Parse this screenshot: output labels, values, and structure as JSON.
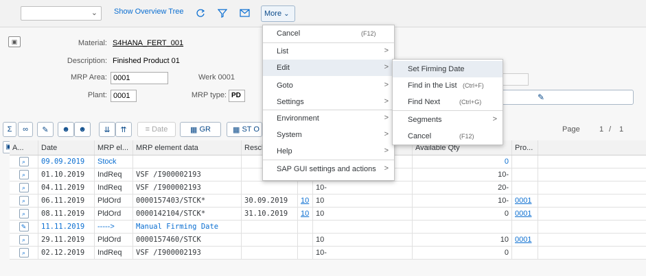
{
  "toolbar": {
    "select_value": "",
    "show_overview_tree": "Show Overview Tree",
    "more": "More"
  },
  "header": {
    "material_label": "Material:",
    "material_value": "S4HANA_FERT_001",
    "description_label": "Description:",
    "description_value": "Finished Product 01",
    "mrp_area_label": "MRP Area:",
    "mrp_area_value": "0001",
    "mrp_area_text": "Werk 0001",
    "plant_label": "Plant:",
    "plant_value": "0001",
    "mrp_type_label": "MRP type:",
    "mrp_type_value": "PD"
  },
  "gridbar": {
    "date_btn": "Date",
    "gr_btn": "GR",
    "st_btn": "ST O",
    "page_label": "Page",
    "page_current": "1",
    "page_sep": "/",
    "page_total": "1"
  },
  "table": {
    "headers": [
      "A...",
      "Date",
      "MRP el...",
      "MRP element data",
      "Resch",
      "",
      "",
      "Available Qty",
      "Pro..."
    ],
    "rows": [
      {
        "icon": "magnifier-icon",
        "date": "09.09.2019",
        "el": "Stock",
        "data": "",
        "resch": "",
        "e": "",
        "rec": "",
        "avail": "0",
        "pro": "",
        "style": "blue"
      },
      {
        "icon": "magnifier-icon",
        "date": "01.10.2019",
        "el": "IndReq",
        "data": "VSF /I900002193",
        "resch": "",
        "e": "",
        "rec": "10-",
        "avail": "10-",
        "pro": "",
        "style": ""
      },
      {
        "icon": "magnifier-icon",
        "date": "04.11.2019",
        "el": "IndReq",
        "data": "VSF /I900002193",
        "resch": "",
        "e": "",
        "rec": "10-",
        "avail": "20-",
        "pro": "",
        "style": ""
      },
      {
        "icon": "magnifier-icon",
        "date": "06.11.2019",
        "el": "PldOrd",
        "data": "0000157403/STCK*",
        "resch": "30.09.2019",
        "e": "10",
        "rec": "10",
        "avail": "10-",
        "pro": "0001",
        "style": ""
      },
      {
        "icon": "magnifier-icon",
        "date": "08.11.2019",
        "el": "PldOrd",
        "data": "0000142104/STCK*",
        "resch": "31.10.2019",
        "e": "10",
        "rec": "10",
        "avail": "0",
        "pro": "0001",
        "style": ""
      },
      {
        "icon": "pencil-icon",
        "date": "11.11.2019",
        "el": "----->",
        "data": "Manual Firming Date",
        "resch": "",
        "e": "",
        "rec": "",
        "avail": "",
        "pro": "",
        "style": "blue"
      },
      {
        "icon": "magnifier-icon",
        "date": "29.11.2019",
        "el": "PldOrd",
        "data": "0000157460/STCK",
        "resch": "",
        "e": "",
        "rec": "10",
        "avail": "10",
        "pro": "0001",
        "style": ""
      },
      {
        "icon": "magnifier-icon",
        "date": "02.12.2019",
        "el": "IndReq",
        "data": "VSF /I900002193",
        "resch": "",
        "e": "",
        "rec": "10-",
        "avail": "0",
        "pro": "",
        "style": ""
      }
    ]
  },
  "more_menu": {
    "items": [
      {
        "label": "Cancel",
        "shortcut": "(F12)",
        "arrow": ""
      },
      {
        "label": "List",
        "shortcut": "",
        "arrow": ">"
      },
      {
        "label": "Edit",
        "shortcut": "",
        "arrow": ">"
      },
      {
        "label": "Goto",
        "shortcut": "",
        "arrow": ">"
      },
      {
        "label": "Settings",
        "shortcut": "",
        "arrow": ">"
      },
      {
        "label": "Environment",
        "shortcut": "",
        "arrow": ">"
      },
      {
        "label": "System",
        "shortcut": "",
        "arrow": ">"
      },
      {
        "label": "Help",
        "shortcut": "",
        "arrow": ">"
      },
      {
        "label": "SAP GUI settings and actions",
        "shortcut": "",
        "arrow": ">"
      }
    ]
  },
  "edit_submenu": {
    "items": [
      {
        "label": "Set Firming Date",
        "shortcut": "",
        "arrow": ""
      },
      {
        "label": "Find in the List",
        "shortcut": "(Ctrl+F)",
        "arrow": ""
      },
      {
        "label": "Find Next",
        "shortcut": "(Ctrl+G)",
        "arrow": ""
      },
      {
        "label": "Segments",
        "shortcut": "",
        "arrow": ">"
      },
      {
        "label": "Cancel",
        "shortcut": "(F12)",
        "arrow": ""
      }
    ]
  }
}
